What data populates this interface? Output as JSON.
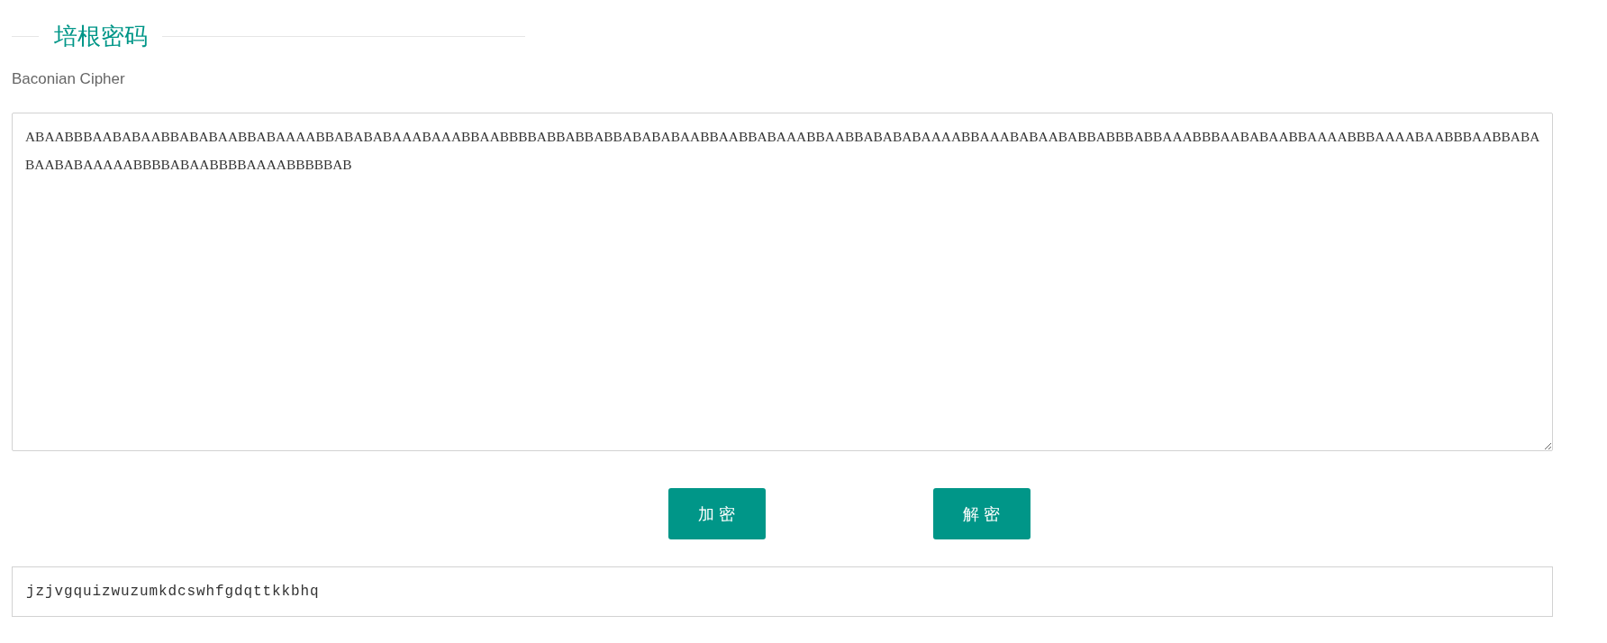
{
  "heading": {
    "title": "培根密码",
    "subtitle": "Baconian Cipher"
  },
  "input": {
    "value": "ABAABBBAABABAABBABABAABBABAAAABBABABABAAABAAABBAABBBBABBABBABBABABABAABBAABBABAAABBAABBABABABAAAABBAAABABAABABBABBBABBAAABBBAABABAABBAAAABBBAAAABAABBBAABBABABAABABAAAAABBBBABAABBBBAAAABBBBBAB"
  },
  "buttons": [
    {
      "label": "加 密"
    },
    {
      "label": "解 密"
    }
  ],
  "output": {
    "value": "jzjvgquizwuzumkdcswhfgdqttkkbhq"
  }
}
